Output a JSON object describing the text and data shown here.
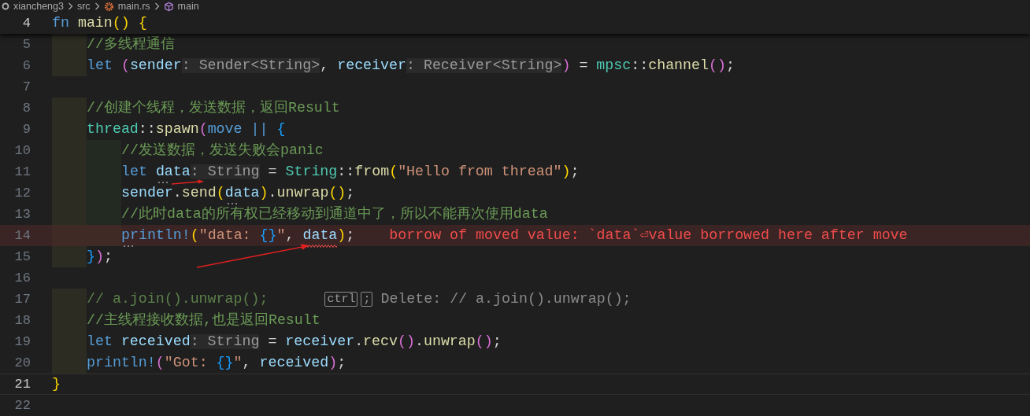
{
  "breadcrumb": [
    {
      "kind": "folder",
      "text": "xiancheng3"
    },
    {
      "kind": "folder-plain",
      "text": "src"
    },
    {
      "kind": "rust-file",
      "text": "main.rs"
    },
    {
      "kind": "module",
      "text": "main"
    }
  ],
  "sticky_line": {
    "number": "4",
    "tokens": [
      {
        "kind": "kw",
        "text": "fn"
      },
      {
        "kind": "fn",
        "text": " main"
      },
      {
        "kind": "b1",
        "text": "()"
      },
      {
        "kind": "b1",
        "text": " {"
      }
    ]
  },
  "lines": [
    {
      "number": "5",
      "current": false,
      "tokens": [
        {
          "kind": "comment",
          "text": "    //多线程通信"
        }
      ]
    },
    {
      "number": "6",
      "current": false,
      "tokens": [
        {
          "kind": "kw",
          "text": "    let"
        },
        {
          "kind": "b2",
          "text": " ("
        },
        {
          "kind": "var",
          "text": "sender"
        },
        {
          "kind": "hint",
          "text": ": Sender<String>"
        },
        {
          "kind": "plain",
          "text": ","
        },
        {
          "kind": "var",
          "text": " receiver"
        },
        {
          "kind": "hint",
          "text": ": Receiver<String>"
        },
        {
          "kind": "b2",
          "text": ")"
        },
        {
          "kind": "plain",
          "text": " = "
        },
        {
          "kind": "type",
          "text": "mpsc"
        },
        {
          "kind": "plain",
          "text": "::"
        },
        {
          "kind": "fn",
          "text": "channel"
        },
        {
          "kind": "b2",
          "text": "()"
        },
        {
          "kind": "plain",
          "text": ";"
        }
      ]
    },
    {
      "number": "7",
      "current": false
    },
    {
      "number": "8",
      "current": false,
      "tokens": [
        {
          "kind": "comment",
          "text": "    //创建个线程，发送数据，返回Result"
        }
      ]
    },
    {
      "number": "9",
      "current": false,
      "tokens": [
        {
          "kind": "type",
          "text": "    thread"
        },
        {
          "kind": "plain",
          "text": "::"
        },
        {
          "kind": "fn",
          "text": "spawn"
        },
        {
          "kind": "b2",
          "text": "("
        },
        {
          "kind": "kw",
          "text": "move"
        },
        {
          "kind": "kw",
          "text": " ||"
        },
        {
          "kind": "b3",
          "text": " {"
        }
      ]
    },
    {
      "number": "10",
      "current": false,
      "tokens": [
        {
          "kind": "comment",
          "text": "        //发送数据，发送失败会panic"
        }
      ]
    },
    {
      "number": "11",
      "current": false,
      "tokens": [
        {
          "kind": "kw",
          "text": "        let"
        },
        {
          "kind": "var",
          "text": " data",
          "dotted": true
        },
        {
          "kind": "hint",
          "text": ": String"
        },
        {
          "kind": "plain",
          "text": " = "
        },
        {
          "kind": "type",
          "text": "String"
        },
        {
          "kind": "plain",
          "text": "::"
        },
        {
          "kind": "fn",
          "text": "from"
        },
        {
          "kind": "b1",
          "text": "("
        },
        {
          "kind": "str",
          "text": "\"Hello from thread\""
        },
        {
          "kind": "b1",
          "text": ")"
        },
        {
          "kind": "plain",
          "text": ";"
        }
      ]
    },
    {
      "number": "12",
      "current": false,
      "tokens": [
        {
          "kind": "var",
          "text": "        sender"
        },
        {
          "kind": "plain",
          "text": "."
        },
        {
          "kind": "fn",
          "text": "send"
        },
        {
          "kind": "b1",
          "text": "("
        },
        {
          "kind": "var",
          "text": "data",
          "dotted": true
        },
        {
          "kind": "b1",
          "text": ")"
        },
        {
          "kind": "plain",
          "text": "."
        },
        {
          "kind": "fn",
          "text": "unwrap"
        },
        {
          "kind": "b1",
          "text": "()"
        },
        {
          "kind": "plain",
          "text": ";"
        }
      ]
    },
    {
      "number": "13",
      "current": false,
      "tokens": [
        {
          "kind": "comment",
          "text": "        //此时data的所有权已经移动到通道中了，所以不能再次使用data"
        }
      ]
    },
    {
      "number": "14",
      "current": false,
      "error": true,
      "tokens": [
        {
          "kind": "macro",
          "text": "        println!",
          "dotted": true
        },
        {
          "kind": "b1",
          "text": "("
        },
        {
          "kind": "str",
          "text": "\"data: "
        },
        {
          "kind": "b3",
          "text": "{}"
        },
        {
          "kind": "str",
          "text": "\""
        },
        {
          "kind": "plain",
          "text": ","
        },
        {
          "kind": "var",
          "text": " data",
          "squiggle": true
        },
        {
          "kind": "b1",
          "text": ")"
        },
        {
          "kind": "plain",
          "text": ";"
        }
      ],
      "diagnostic": "borrow of moved value: `data`⏎value borrowed here after move"
    },
    {
      "number": "15",
      "current": false,
      "tokens": [
        {
          "kind": "b3",
          "text": "    }"
        },
        {
          "kind": "b2",
          "text": ")"
        },
        {
          "kind": "plain",
          "text": ";"
        }
      ]
    },
    {
      "number": "16",
      "current": false
    },
    {
      "number": "17",
      "current": false,
      "tokens": [
        {
          "kind": "comment-faded",
          "text": "    // a.join().unwrap();"
        }
      ],
      "ghost": {
        "keys": [
          "ctrl",
          ";"
        ],
        "text": "Delete: // a.join().unwrap();"
      }
    },
    {
      "number": "18",
      "current": false,
      "tokens": [
        {
          "kind": "comment",
          "text": "    //主线程接收数据,也是返回Result"
        }
      ]
    },
    {
      "number": "19",
      "current": false,
      "tokens": [
        {
          "kind": "kw",
          "text": "    let"
        },
        {
          "kind": "var",
          "text": " received"
        },
        {
          "kind": "hint",
          "text": ": String"
        },
        {
          "kind": "plain",
          "text": " = "
        },
        {
          "kind": "var",
          "text": "receiver"
        },
        {
          "kind": "plain",
          "text": "."
        },
        {
          "kind": "fn",
          "text": "recv"
        },
        {
          "kind": "b2",
          "text": "()"
        },
        {
          "kind": "plain",
          "text": "."
        },
        {
          "kind": "fn",
          "text": "unwrap"
        },
        {
          "kind": "b2",
          "text": "()"
        },
        {
          "kind": "plain",
          "text": ";"
        }
      ]
    },
    {
      "number": "20",
      "current": false,
      "tokens": [
        {
          "kind": "macro",
          "text": "    println!"
        },
        {
          "kind": "b2",
          "text": "("
        },
        {
          "kind": "str",
          "text": "\"Got: "
        },
        {
          "kind": "b3",
          "text": "{}"
        },
        {
          "kind": "str",
          "text": "\""
        },
        {
          "kind": "plain",
          "text": ","
        },
        {
          "kind": "var",
          "text": " received"
        },
        {
          "kind": "b2",
          "text": ")"
        },
        {
          "kind": "plain",
          "text": ";"
        }
      ]
    },
    {
      "number": "21",
      "current": true,
      "tokens": [
        {
          "kind": "b1",
          "text": "}"
        }
      ]
    },
    {
      "number": "22",
      "current": false
    }
  ]
}
